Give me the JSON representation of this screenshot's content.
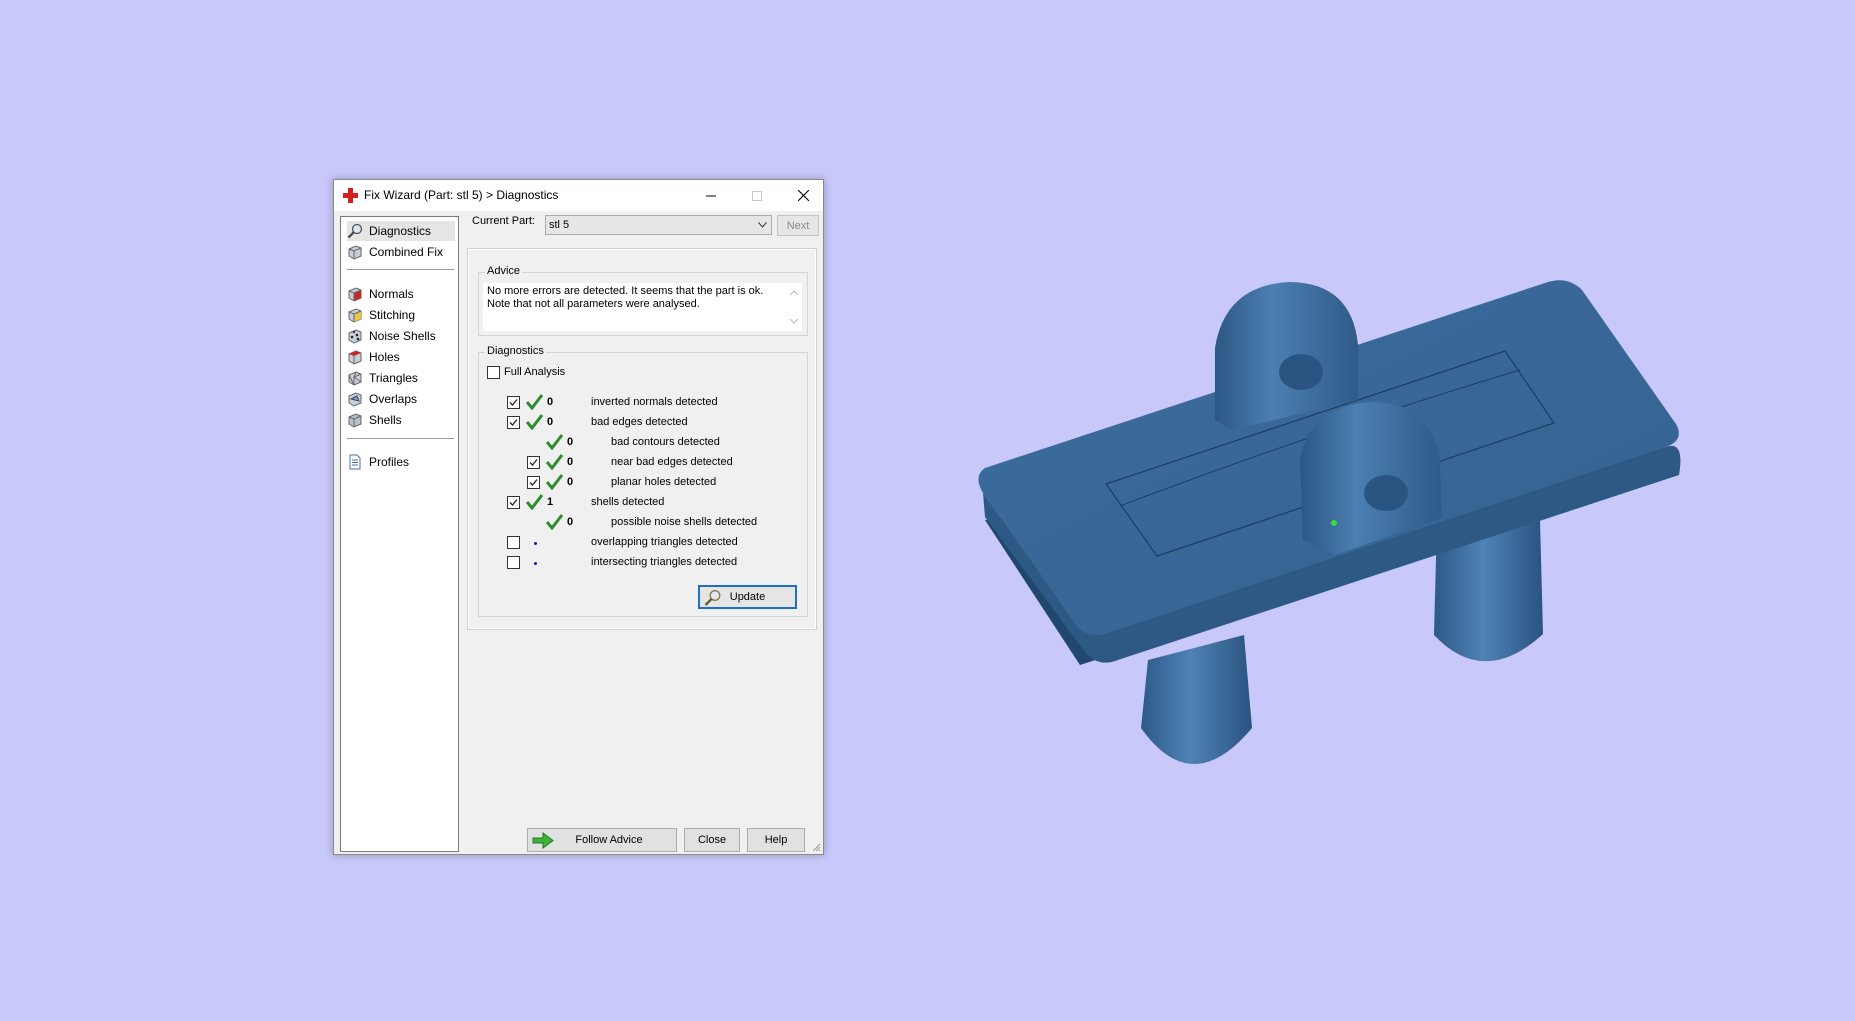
{
  "window": {
    "title": "Fix Wizard (Part: stl 5) > Diagnostics",
    "minimize_icon": "minimize-icon",
    "maximize_icon": "maximize-icon",
    "close_icon": "close-icon"
  },
  "nav": {
    "items": [
      {
        "label": "Diagnostics",
        "icon": "magnifier-icon",
        "selected": true
      },
      {
        "label": "Combined Fix",
        "icon": "cube-icon"
      },
      {
        "label": "Normals",
        "icon": "normals-cube-icon"
      },
      {
        "label": "Stitching",
        "icon": "stitching-cube-icon"
      },
      {
        "label": "Noise Shells",
        "icon": "noise-shells-icon"
      },
      {
        "label": "Holes",
        "icon": "holes-cube-icon"
      },
      {
        "label": "Triangles",
        "icon": "triangles-cube-icon"
      },
      {
        "label": "Overlaps",
        "icon": "overlaps-cube-icon"
      },
      {
        "label": "Shells",
        "icon": "shells-cube-icon"
      },
      {
        "label": "Profiles",
        "icon": "document-icon"
      }
    ]
  },
  "header": {
    "current_part_label": "Current Part:",
    "current_part_value": "stl 5",
    "next_label": "Next"
  },
  "advice": {
    "title": "Advice",
    "line1": "No more errors are detected. It seems that the part is ok.",
    "line2": "Note that not all parameters were analysed."
  },
  "diagnostics": {
    "title": "Diagnostics",
    "full_analysis_label": "Full Analysis",
    "full_analysis_checked": false,
    "rows": [
      {
        "count": "0",
        "text": "inverted normals detected",
        "checked": true
      },
      {
        "count": "0",
        "text": "bad edges detected",
        "checked": true
      },
      {
        "count": "0",
        "text": "bad contours detected"
      },
      {
        "count": "0",
        "text": "near bad edges detected",
        "checked": true
      },
      {
        "count": "0",
        "text": "planar holes detected",
        "checked": true
      },
      {
        "count": "1",
        "text": "shells detected",
        "checked": true
      },
      {
        "count": "0",
        "text": "possible noise shells detected"
      },
      {
        "count": "",
        "text": "overlapping triangles detected",
        "checked": false
      },
      {
        "count": "",
        "text": "intersecting triangles detected",
        "checked": false
      }
    ],
    "update_label": "Update"
  },
  "footer": {
    "follow_advice_label": "Follow Advice",
    "close_label": "Close",
    "help_label": "Help"
  },
  "colors": {
    "background": "#c8c8fa",
    "model_blue": "#3f6f9f",
    "check_green": "#2e8b2e",
    "accent": "#1e6fc8"
  }
}
